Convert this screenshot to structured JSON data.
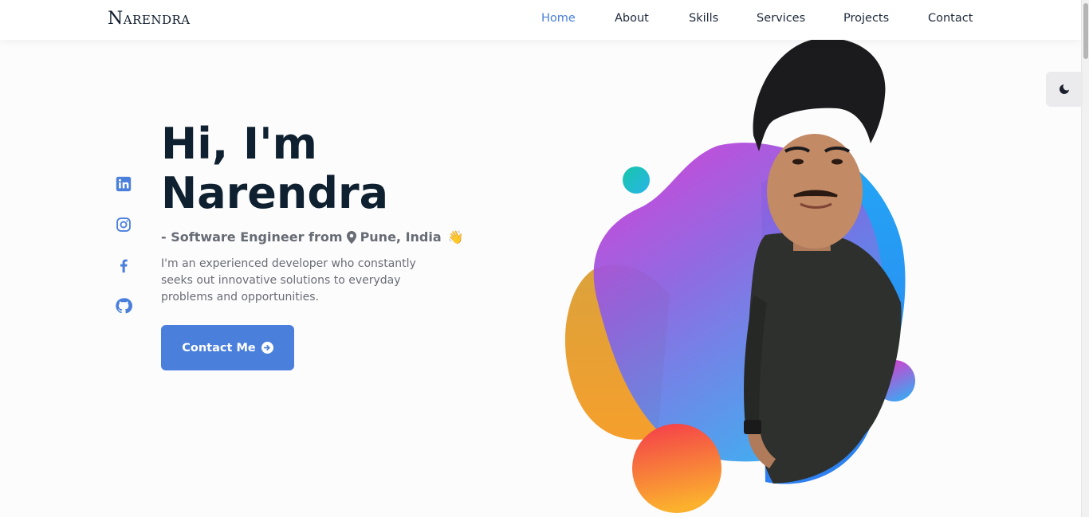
{
  "header": {
    "logo": "Narendra",
    "nav": [
      {
        "label": "Home",
        "active": true
      },
      {
        "label": "About",
        "active": false
      },
      {
        "label": "Skills",
        "active": false
      },
      {
        "label": "Services",
        "active": false
      },
      {
        "label": "Projects",
        "active": false
      },
      {
        "label": "Contact",
        "active": false
      }
    ]
  },
  "theme_toggle": {
    "icon": "moon-icon"
  },
  "socials": [
    {
      "icon": "linkedin-icon"
    },
    {
      "icon": "instagram-icon"
    },
    {
      "icon": "facebook-icon"
    },
    {
      "icon": "github-icon"
    }
  ],
  "hero": {
    "greeting_line1": "Hi, I'm",
    "greeting_line2": "Narendra",
    "subtitle_prefix": "- Software Engineer from",
    "location": "Pune, India",
    "wave_emoji": "👋",
    "description": "I'm an experienced developer who constantly seeks out innovative solutions to everyday problems and opportunities.",
    "cta_label": "Contact Me",
    "cta_icon": "arrow-circle-right-icon"
  },
  "colors": {
    "accent": "#4a7fdb",
    "heading": "#0f2130",
    "body_text": "#6a6d75"
  }
}
